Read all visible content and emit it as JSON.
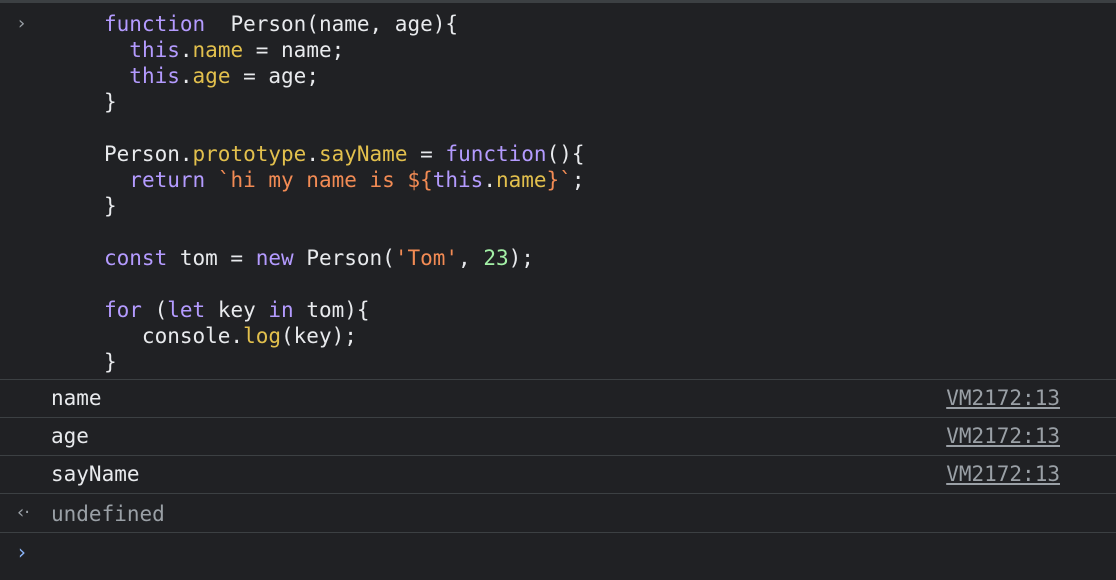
{
  "input_code": {
    "prompt_glyph": "›",
    "lines": [
      [
        {
          "t": "function",
          "c": "kw"
        },
        {
          "t": "  Person(name, age){",
          "c": ""
        }
      ],
      [
        {
          "t": "  ",
          "c": ""
        },
        {
          "t": "this",
          "c": "kw"
        },
        {
          "t": ".",
          "c": ""
        },
        {
          "t": "name",
          "c": "prop"
        },
        {
          "t": " = name;",
          "c": ""
        }
      ],
      [
        {
          "t": "  ",
          "c": ""
        },
        {
          "t": "this",
          "c": "kw"
        },
        {
          "t": ".",
          "c": ""
        },
        {
          "t": "age",
          "c": "prop"
        },
        {
          "t": " = age;",
          "c": ""
        }
      ],
      [
        {
          "t": "}",
          "c": ""
        }
      ],
      [
        {
          "t": "",
          "c": ""
        }
      ],
      [
        {
          "t": "Person.",
          "c": ""
        },
        {
          "t": "prototype",
          "c": "prop"
        },
        {
          "t": ".",
          "c": ""
        },
        {
          "t": "sayName",
          "c": "prop"
        },
        {
          "t": " = ",
          "c": ""
        },
        {
          "t": "function",
          "c": "kw"
        },
        {
          "t": "(){",
          "c": ""
        }
      ],
      [
        {
          "t": "  ",
          "c": ""
        },
        {
          "t": "return",
          "c": "kw"
        },
        {
          "t": " `hi my name is ${",
          "c": "tpl"
        },
        {
          "t": "this",
          "c": "kw"
        },
        {
          "t": ".",
          "c": ""
        },
        {
          "t": "name",
          "c": "prop"
        },
        {
          "t": "}`",
          "c": "tpl"
        },
        {
          "t": ";",
          "c": ""
        }
      ],
      [
        {
          "t": "}",
          "c": ""
        }
      ],
      [
        {
          "t": "",
          "c": ""
        }
      ],
      [
        {
          "t": "const",
          "c": "kw"
        },
        {
          "t": " tom = ",
          "c": ""
        },
        {
          "t": "new",
          "c": "kw"
        },
        {
          "t": " Person(",
          "c": ""
        },
        {
          "t": "'Tom'",
          "c": "str"
        },
        {
          "t": ", ",
          "c": ""
        },
        {
          "t": "23",
          "c": "num"
        },
        {
          "t": ");",
          "c": ""
        }
      ],
      [
        {
          "t": "",
          "c": ""
        }
      ],
      [
        {
          "t": "for",
          "c": "kw"
        },
        {
          "t": " (",
          "c": ""
        },
        {
          "t": "let",
          "c": "kw"
        },
        {
          "t": " key ",
          "c": ""
        },
        {
          "t": "in",
          "c": "kw"
        },
        {
          "t": " tom){",
          "c": ""
        }
      ],
      [
        {
          "t": "   console.",
          "c": ""
        },
        {
          "t": "log",
          "c": "prop"
        },
        {
          "t": "(key);",
          "c": ""
        }
      ],
      [
        {
          "t": "}",
          "c": ""
        }
      ]
    ]
  },
  "logs": [
    {
      "text": "name",
      "source": "VM2172:13"
    },
    {
      "text": "age",
      "source": "VM2172:13"
    },
    {
      "text": "sayName",
      "source": "VM2172:13"
    }
  ],
  "result": {
    "glyph": "‹·",
    "text": "undefined"
  },
  "input": {
    "prompt_glyph": "›",
    "value": "",
    "placeholder": ""
  },
  "colors": {
    "background": "#202124",
    "keyword": "#b49bff",
    "property": "#e2c04d",
    "string": "#f28b54",
    "number": "#a3f0a6",
    "prompt_accent": "#8ab4f8"
  }
}
